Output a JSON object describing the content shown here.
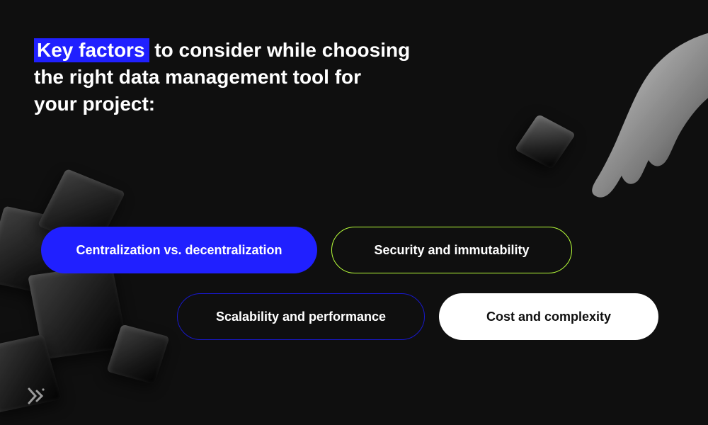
{
  "title": {
    "highlighted": "Key factors",
    "rest_line1": " to consider while choosing",
    "line2": "the right data management tool for",
    "line3": "your project:"
  },
  "pills": {
    "p1": "Centralization vs. decentralization",
    "p2": "Security and immutability",
    "p3": "Scalability and performance",
    "p4": "Cost and complexity"
  },
  "colors": {
    "accent_blue": "#2020ff",
    "accent_lime": "#b8ff3a",
    "bg": "#0f0f0f"
  }
}
